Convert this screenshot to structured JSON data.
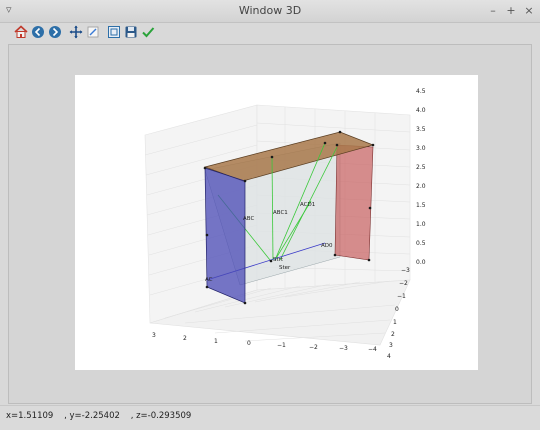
{
  "window": {
    "title": "Window 3D",
    "menu_glyph": "▿",
    "controls": {
      "minimize": "–",
      "maximize": "+",
      "close": "×"
    }
  },
  "toolbar": {
    "buttons": [
      {
        "icon": "home-icon",
        "label": "Home"
      },
      {
        "icon": "back-icon",
        "label": "Back"
      },
      {
        "icon": "forward-icon",
        "label": "Forward"
      },
      {
        "icon": "pan-icon",
        "label": "Pan"
      },
      {
        "icon": "zoom-icon",
        "label": "Zoom"
      },
      {
        "icon": "subplots-icon",
        "label": "Configure subplots"
      },
      {
        "icon": "save-icon",
        "label": "Save"
      },
      {
        "icon": "check-icon",
        "label": "Apply"
      }
    ]
  },
  "plot": {
    "z_ticks": [
      "4.5",
      "4.0",
      "3.5",
      "3.0",
      "2.5",
      "2.0",
      "1.5",
      "1.0",
      "0.5",
      "0.0"
    ],
    "y_ticks": [
      "−3",
      "−2",
      "−1",
      "0",
      "1",
      "2",
      "3",
      "4"
    ],
    "x_ticks": [
      "3",
      "2",
      "1",
      "0",
      "−1",
      "−2",
      "−3",
      "−4"
    ],
    "labels": {
      "abc1": "ABC1",
      "acd1": "ACD1",
      "abc_left": "ABC",
      "ab0": "AB0",
      "ad0": "AD0",
      "st": "Strt",
      "ster": "Ster",
      "ac": "AC"
    },
    "colors": {
      "blue_wall": "#4a4ab5",
      "red_wall": "#c86060",
      "brown_roof": "#a8784a",
      "green_line": "#3ac83a",
      "back_wall": "#d8dde0"
    }
  },
  "status": {
    "text": "x=1.51109    , y=-2.25402    , z=-0.293509"
  }
}
